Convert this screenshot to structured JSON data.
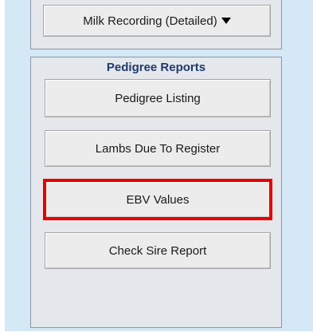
{
  "milk_recording_button": {
    "label": "Milk Recording (Detailed)",
    "icon": "caret-down-icon"
  },
  "pedigree_reports": {
    "title": "Pedigree Reports",
    "buttons": [
      {
        "label": "Pedigree Listing"
      },
      {
        "label": "Lambs Due To Register"
      },
      {
        "label": "EBV Values"
      },
      {
        "label": "Check Sire Report"
      }
    ]
  },
  "colors": {
    "background": "#d5e8f5",
    "panel": "#e4e7ec",
    "title_text": "#1f3a6e",
    "highlight": "#e60000"
  }
}
